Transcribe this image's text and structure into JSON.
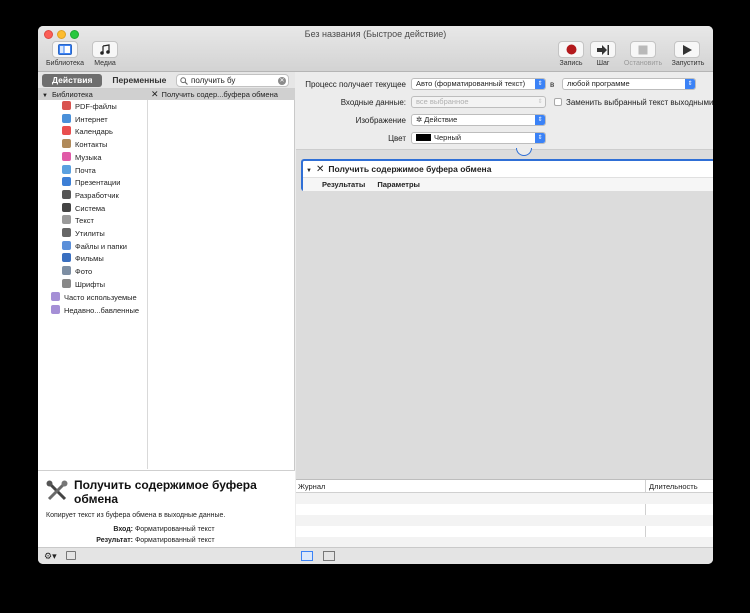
{
  "window": {
    "title": "Без названия (Быстрое действие)"
  },
  "toolbar": {
    "library_label": "Библиотека",
    "media_label": "Медиа",
    "record_label": "Запись",
    "step_label": "Шаг",
    "stop_label": "Остановить",
    "run_label": "Запустить"
  },
  "left": {
    "tab_actions": "Действия",
    "tab_variables": "Переменные",
    "search_value": "получить бу",
    "library_root": "Библиотека",
    "categories": [
      {
        "label": "PDF-файлы",
        "color": "#d9534f"
      },
      {
        "label": "Интернет",
        "color": "#4a90d9"
      },
      {
        "label": "Календарь",
        "color": "#e94e4e"
      },
      {
        "label": "Контакты",
        "color": "#b08a5a"
      },
      {
        "label": "Музыка",
        "color": "#e05aa7"
      },
      {
        "label": "Почта",
        "color": "#5aa0e0"
      },
      {
        "label": "Презентации",
        "color": "#3d7fd6"
      },
      {
        "label": "Разработчик",
        "color": "#555555"
      },
      {
        "label": "Система",
        "color": "#444444"
      },
      {
        "label": "Текст",
        "color": "#9a9a9a"
      },
      {
        "label": "Утилиты",
        "color": "#666666"
      },
      {
        "label": "Файлы и папки",
        "color": "#5b8fd9"
      },
      {
        "label": "Фильмы",
        "color": "#3a6fc0"
      },
      {
        "label": "Фото",
        "color": "#7d8ea3"
      },
      {
        "label": "Шрифты",
        "color": "#888888"
      }
    ],
    "smart_groups": [
      {
        "label": "Часто используемые",
        "color": "#a58fd6"
      },
      {
        "label": "Недавно...бавленные",
        "color": "#a58fd6"
      }
    ],
    "selected_action": "Получить содер...буфера обмена"
  },
  "description": {
    "title": "Получить содержимое буфера обмена",
    "text": "Копирует текст из буфера обмена в выходные данные.",
    "input_key": "Вход:",
    "input_value": "Форматированный текст",
    "result_key": "Результат:",
    "result_value": "Форматированный текст"
  },
  "params": {
    "receives_label": "Процесс получает текущее",
    "receives_value": "Авто (форматированный текст)",
    "in_label": "в",
    "app_value": "любой программе",
    "input_label": "Входные данные:",
    "input_value": "все выбранное",
    "replace_label": "Заменить выбранный текст выходными",
    "image_label": "Изображение",
    "image_value": "Действие",
    "color_label": "Цвет",
    "color_value": "Черный"
  },
  "workflow": {
    "action_title": "Получить содержимое буфера обмена",
    "tab_results": "Результаты",
    "tab_params": "Параметры"
  },
  "log": {
    "col_log": "Журнал",
    "col_duration": "Длительность"
  }
}
